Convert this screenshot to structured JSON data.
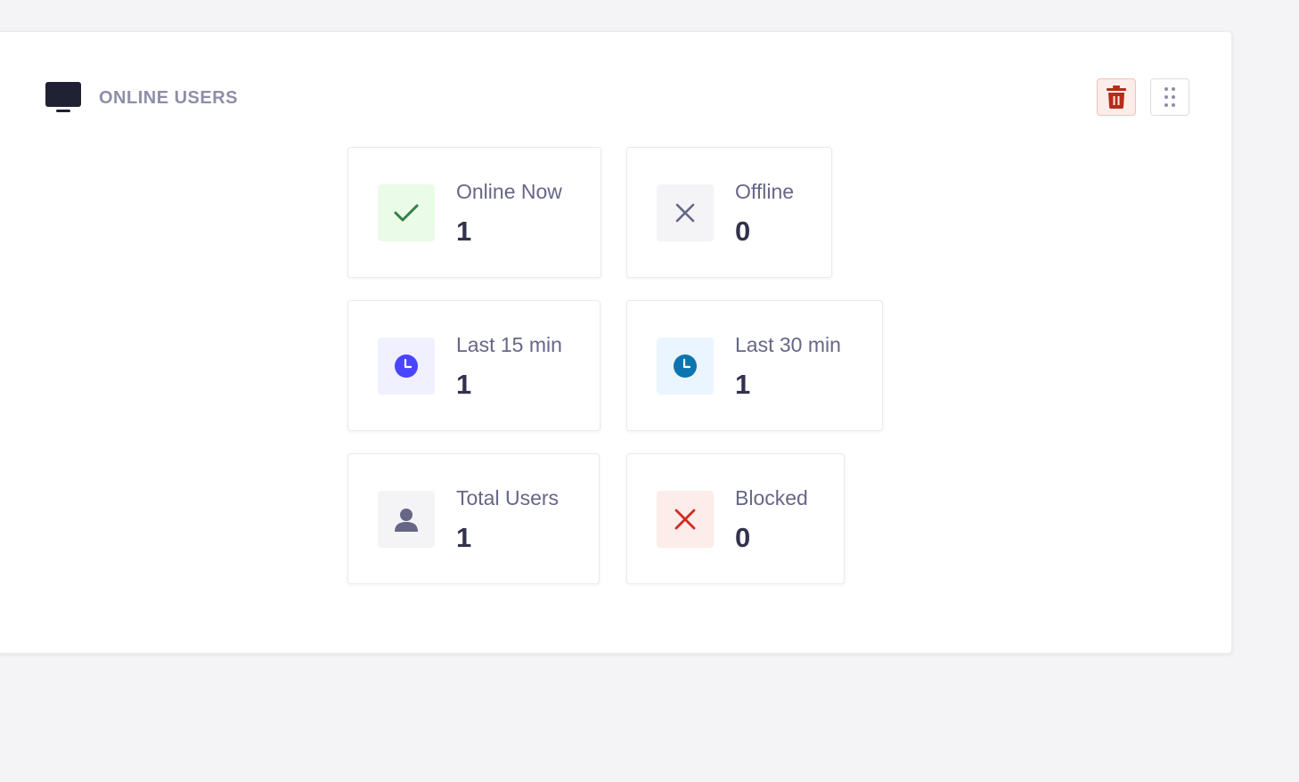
{
  "widget": {
    "title": "ONLINE USERS",
    "icon": "monitor-icon",
    "actions": [
      {
        "name": "delete",
        "icon": "trash-icon",
        "color": "#b72b1a"
      },
      {
        "name": "drag",
        "icon": "drag-handle-icon",
        "color": "#8e8ea9"
      }
    ]
  },
  "stats": [
    {
      "label": "Online Now",
      "value": "1",
      "icon": "check-icon",
      "accent": "#328048",
      "bg": "#eafbe7"
    },
    {
      "label": "Offline",
      "value": "0",
      "icon": "cross-icon",
      "accent": "#666687",
      "bg": "#f4f4f6"
    },
    {
      "label": "Last 15 min",
      "value": "1",
      "icon": "clock-icon",
      "accent": "#4945ff",
      "bg": "#f0f0ff"
    },
    {
      "label": "Last 30 min",
      "value": "1",
      "icon": "clock-icon",
      "accent": "#0c75af",
      "bg": "#eaf5ff"
    },
    {
      "label": "Total Users",
      "value": "1",
      "icon": "user-icon",
      "accent": "#666687",
      "bg": "#f4f4f6"
    },
    {
      "label": "Blocked",
      "value": "0",
      "icon": "cross-icon",
      "accent": "#d02b20",
      "bg": "#fcecea"
    }
  ]
}
